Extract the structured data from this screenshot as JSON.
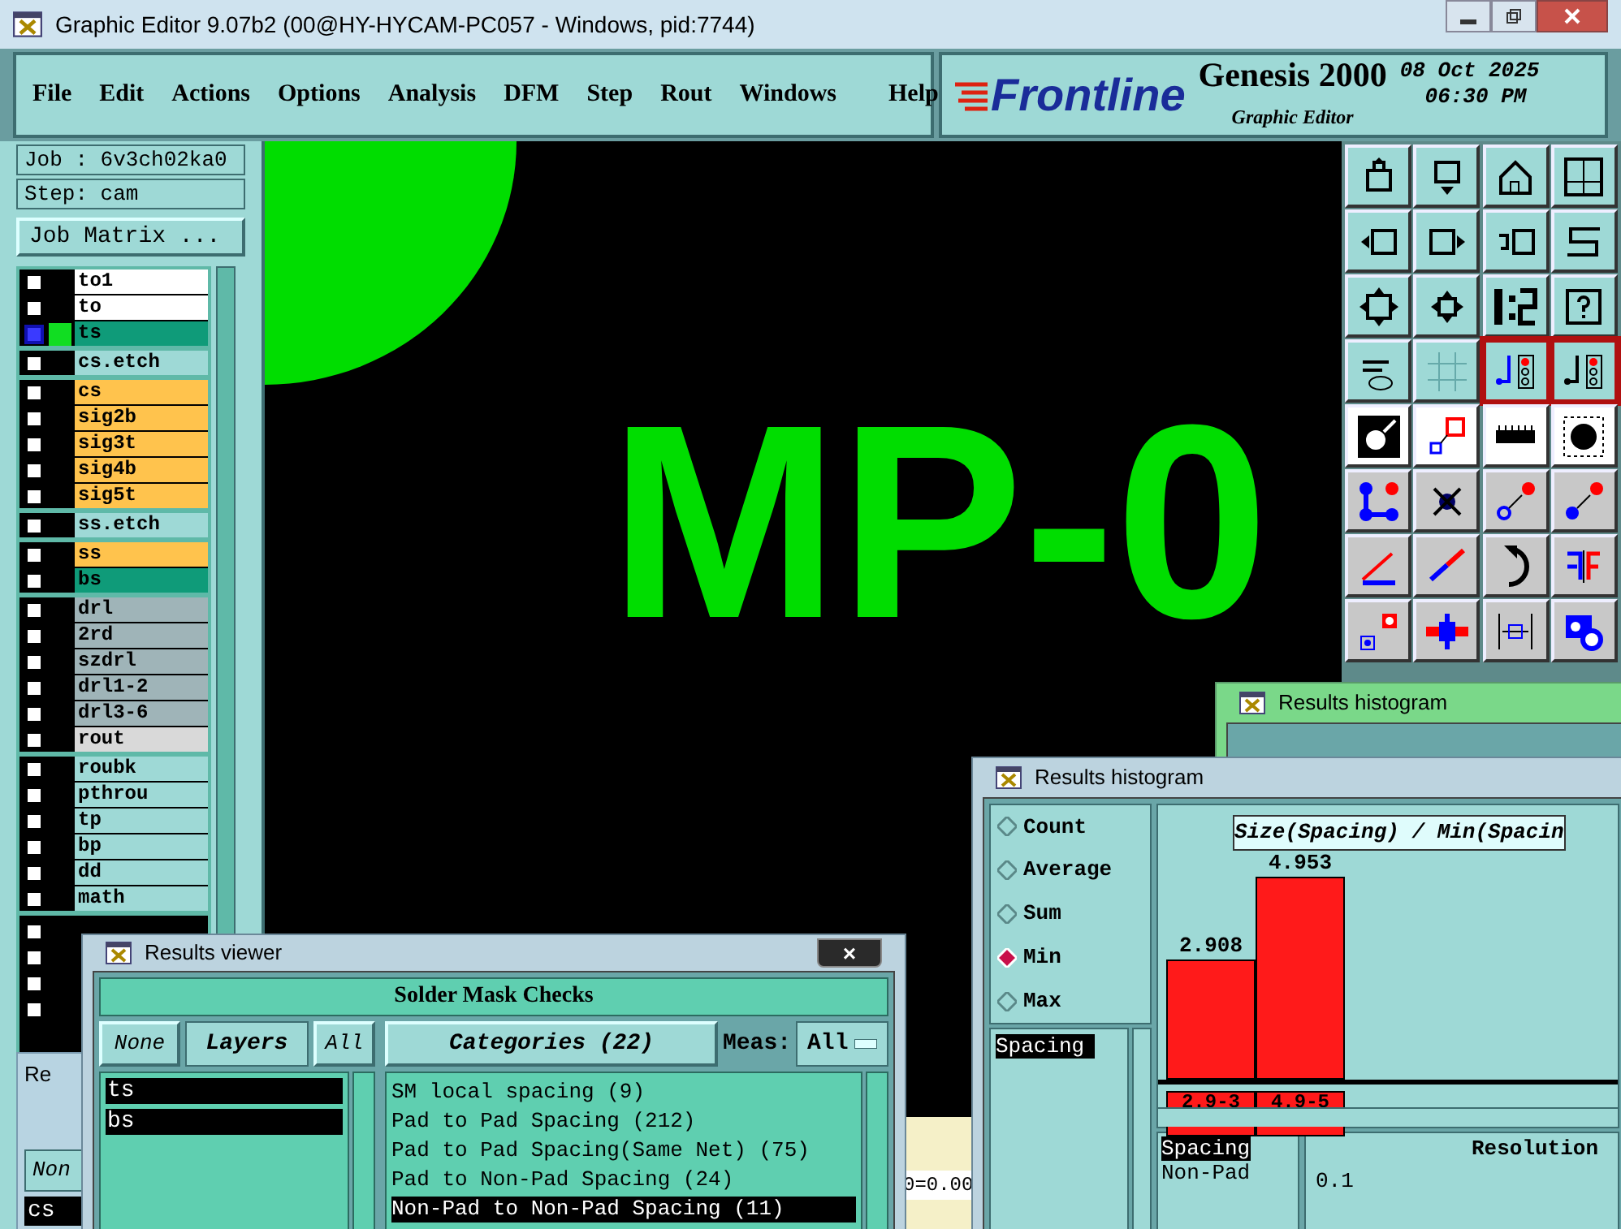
{
  "window": {
    "title": "Graphic Editor 9.07b2 (00@HY-HYCAM-PC057 - Windows, pid:7744)"
  },
  "menu": [
    "File",
    "Edit",
    "Actions",
    "Options",
    "Analysis",
    "DFM",
    "Step",
    "Rout",
    "Windows",
    "Help"
  ],
  "brand": {
    "logo": "Frontline",
    "product": "Genesis 2000",
    "subtitle": "Graphic Editor",
    "date": "08 Oct 2025",
    "time": "06:30 PM"
  },
  "job_panel": {
    "job": "Job : 6v3ch02ka0",
    "step": "Step: cam",
    "matrix_button": "Job Matrix ...",
    "layer_groups": [
      [
        {
          "name": "to1",
          "color": "#ffffff",
          "selected": false
        },
        {
          "name": "to",
          "color": "#ffffff",
          "selected": false
        },
        {
          "name": "ts",
          "color": "#0f9b79",
          "selected": true
        }
      ],
      [
        {
          "name": "cs.etch",
          "color": "#9ed9d6",
          "selected": false
        }
      ],
      [
        {
          "name": "cs",
          "color": "#ffc34d",
          "selected": false
        },
        {
          "name": "sig2b",
          "color": "#ffc34d",
          "selected": false
        },
        {
          "name": "sig3t",
          "color": "#ffc34d",
          "selected": false
        },
        {
          "name": "sig4b",
          "color": "#ffc34d",
          "selected": false
        },
        {
          "name": "sig5t",
          "color": "#ffc34d",
          "selected": false
        }
      ],
      [
        {
          "name": "ss.etch",
          "color": "#9ed9d6",
          "selected": false
        }
      ],
      [
        {
          "name": "ss",
          "color": "#ffc34d",
          "selected": false
        },
        {
          "name": "bs",
          "color": "#0f9b79",
          "selected": false
        }
      ],
      [
        {
          "name": "drl",
          "color": "#9fb4b8",
          "selected": false
        },
        {
          "name": "2rd",
          "color": "#9fb4b8",
          "selected": false
        },
        {
          "name": "szdrl",
          "color": "#9fb4b8",
          "selected": false
        },
        {
          "name": "drl1-2",
          "color": "#9fb4b8",
          "selected": false
        },
        {
          "name": "drl3-6",
          "color": "#9fb4b8",
          "selected": false
        },
        {
          "name": "rout",
          "color": "#d9d9d9",
          "selected": false
        }
      ],
      [
        {
          "name": "roubk",
          "color": "#9ed9d6",
          "selected": false
        },
        {
          "name": "pthrou",
          "color": "#9ed9d6",
          "selected": false
        },
        {
          "name": "tp",
          "color": "#9ed9d6",
          "selected": false
        },
        {
          "name": "bp",
          "color": "#9ed9d6",
          "selected": false
        },
        {
          "name": "dd",
          "color": "#9ed9d6",
          "selected": false
        },
        {
          "name": "math",
          "color": "#9ed9d6",
          "selected": false
        }
      ]
    ],
    "unnamed_rows": [
      {
        "selected": false
      },
      {
        "selected": false
      },
      {
        "selected": false
      },
      {
        "selected": false
      }
    ]
  },
  "canvas": {
    "text": "MP-0"
  },
  "toolbar": [
    {
      "selected": false
    },
    {
      "selected": false
    },
    {
      "selected": false
    },
    {
      "selected": false
    },
    {
      "selected": false
    },
    {
      "selected": false
    },
    {
      "selected": false
    },
    {
      "selected": false
    },
    {
      "selected": false
    },
    {
      "selected": false
    },
    {
      "selected": false
    },
    {
      "selected": false
    },
    {
      "selected": false
    },
    {
      "selected": false
    },
    {
      "selected": true
    },
    {
      "selected": true
    },
    {
      "selected": false
    },
    {
      "selected": false
    },
    {
      "selected": false
    },
    {
      "selected": false
    },
    {
      "selected": false
    },
    {
      "selected": false
    },
    {
      "selected": false
    },
    {
      "selected": false
    },
    {
      "selected": false
    },
    {
      "selected": false
    },
    {
      "selected": false
    },
    {
      "selected": false
    },
    {
      "selected": false
    },
    {
      "selected": false
    },
    {
      "selected": false
    },
    {
      "selected": false
    }
  ],
  "status_fragment": "0=0.00",
  "back_window": {
    "title": "Re",
    "button": "Non",
    "item": "cs"
  },
  "results_viewer": {
    "title": "Results viewer",
    "close": "×",
    "header": "Solder Mask Checks",
    "none_button": "None",
    "layers_button": "Layers",
    "all_button": "All",
    "categories_button": "Categories (22)",
    "meas_label": "Meas:",
    "meas_value": "All",
    "layers": [
      {
        "name": "ts",
        "selected": true
      },
      {
        "name": "bs",
        "selected": true
      }
    ],
    "categories": [
      {
        "name": "SM local spacing (9)",
        "selected": false
      },
      {
        "name": "Pad to Pad Spacing (212)",
        "selected": false
      },
      {
        "name": "Pad to Pad Spacing(Same Net) (75)",
        "selected": false
      },
      {
        "name": "Pad to Non-Pad Spacing (24)",
        "selected": false
      },
      {
        "name": "Non-Pad to Non-Pad Spacing (11)",
        "selected": true
      }
    ]
  },
  "back_histogram": {
    "title": "Results histogram"
  },
  "histogram": {
    "title": "Results histogram",
    "modes": [
      {
        "label": "Count",
        "selected": false
      },
      {
        "label": "Average",
        "selected": false
      },
      {
        "label": "Sum",
        "selected": false
      },
      {
        "label": "Min",
        "selected": true
      },
      {
        "label": "Max",
        "selected": false
      }
    ],
    "measures": [
      {
        "name": "Spacing",
        "selected": true
      }
    ],
    "chart_data": {
      "type": "bar",
      "title": "Size(Spacing) / Min(Spacin",
      "categories": [
        "2.9-3",
        "4.9-5"
      ],
      "values": [
        2.908,
        4.953
      ],
      "data_labels": true,
      "value_labels": [
        "2.908",
        "4.953"
      ]
    },
    "bottom_list": [
      {
        "name": "Spacing",
        "selected": true
      },
      {
        "name": "Non-Pad",
        "selected": false
      }
    ],
    "resolution_label": "Resolution",
    "resolution_value": "0.1"
  }
}
